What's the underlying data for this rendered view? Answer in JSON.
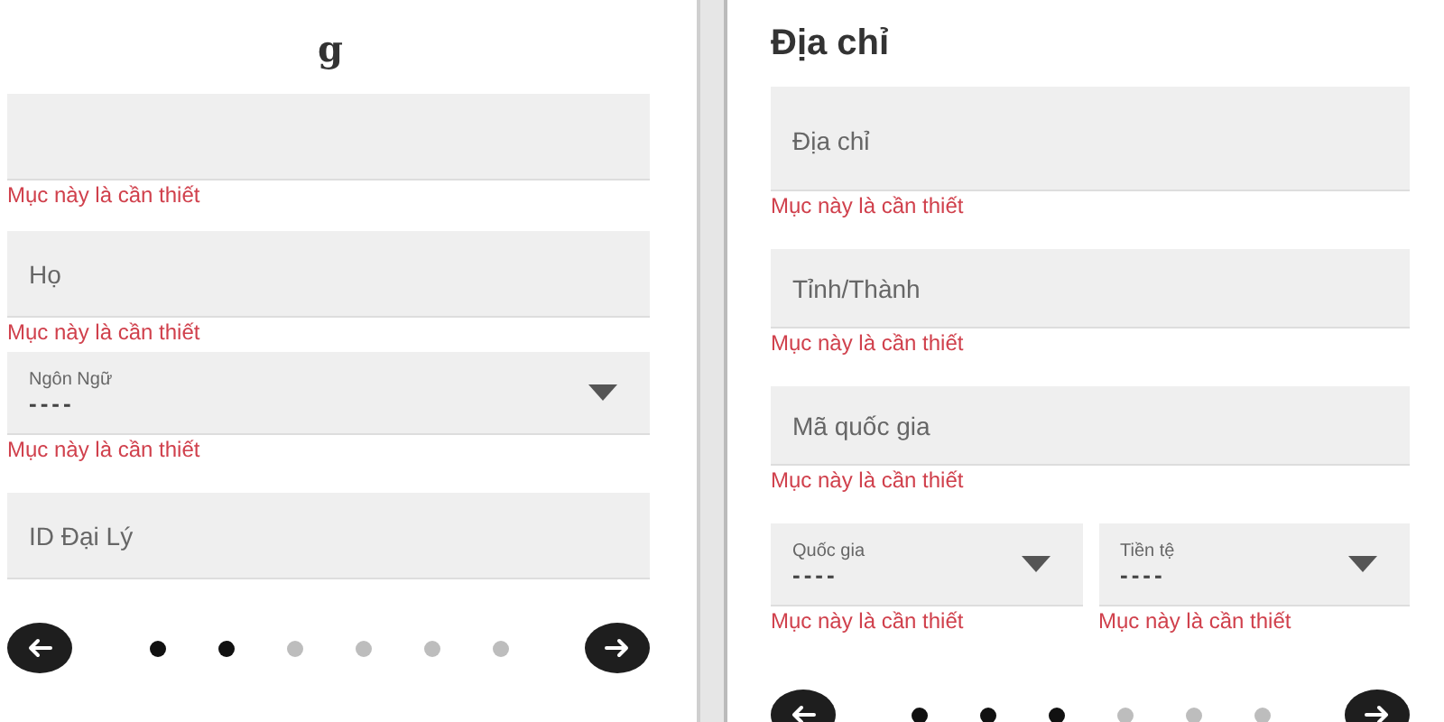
{
  "panels": [
    {
      "heading": "g",
      "fields": [
        {
          "kind": "text",
          "error": "Mục này là cần thiết"
        },
        {
          "kind": "text",
          "placeholder": "Họ",
          "error": "Mục này là cần thiết"
        },
        {
          "kind": "select",
          "label": "Ngôn Ngữ",
          "value": "----",
          "error": "Mục này là cần thiết"
        },
        {
          "kind": "text",
          "placeholder": "ID Đại Lý"
        }
      ],
      "steps": [
        {
          "done": true
        },
        {
          "done": true
        },
        {
          "done": false
        },
        {
          "done": false
        },
        {
          "done": false
        },
        {
          "done": false
        }
      ]
    },
    {
      "heading": "Địa chỉ",
      "fields": [
        {
          "kind": "text",
          "placeholder": "Địa chỉ",
          "error": "Mục này là cần thiết"
        },
        {
          "kind": "text",
          "placeholder": "Tỉnh/Thành",
          "error": "Mục này là cần thiết"
        },
        {
          "kind": "text",
          "placeholder": "Mã quốc gia",
          "error": "Mục này là cần thiết"
        },
        {
          "kind": "row",
          "fields": [
            {
              "kind": "select",
              "label": "Quốc gia",
              "value": "----",
              "error": "Mục này là cần thiết"
            },
            {
              "kind": "select",
              "label": "Tiền tệ",
              "value": "----",
              "error": "Mục này là cần thiết"
            }
          ]
        }
      ],
      "steps": [
        {
          "done": true
        },
        {
          "done": true
        },
        {
          "done": true
        },
        {
          "done": false
        },
        {
          "done": false
        },
        {
          "done": false
        }
      ]
    }
  ]
}
